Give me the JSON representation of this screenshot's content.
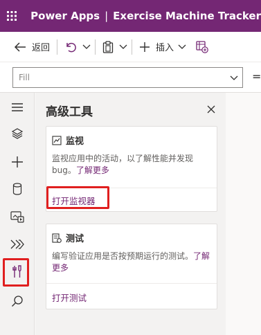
{
  "header": {
    "product": "Power Apps",
    "separator": "|",
    "app_name": "Exercise Machine Tracker",
    "waffle_icon": "waffle-icon",
    "bg_color": "#742774"
  },
  "command_bar": {
    "back_label": "返回",
    "insert_label": "插入"
  },
  "formula_bar": {
    "property_value": "Fill",
    "equals": "="
  },
  "rail": {
    "items": [
      {
        "icon": "hamburger-icon"
      },
      {
        "icon": "layers-icon"
      },
      {
        "icon": "plus-icon"
      },
      {
        "icon": "database-icon"
      },
      {
        "icon": "media-icon"
      },
      {
        "icon": "power-automate-icon"
      },
      {
        "icon": "advanced-tools-icon",
        "active": true
      },
      {
        "icon": "search-icon"
      }
    ]
  },
  "panel": {
    "title": "高级工具",
    "monitor_card": {
      "title": "监视",
      "desc_text": "监视应用中的活动，以了解性能并发现 bug。",
      "learn_more": "了解更多",
      "action": "打开监视器"
    },
    "test_card": {
      "title": "测试",
      "desc_text": "编写验证应用是否按预期运行的测试。",
      "learn_more": "了解更多",
      "action": "打开测试"
    }
  },
  "colors": {
    "accent": "#742774",
    "highlight": "#e01f1f"
  }
}
